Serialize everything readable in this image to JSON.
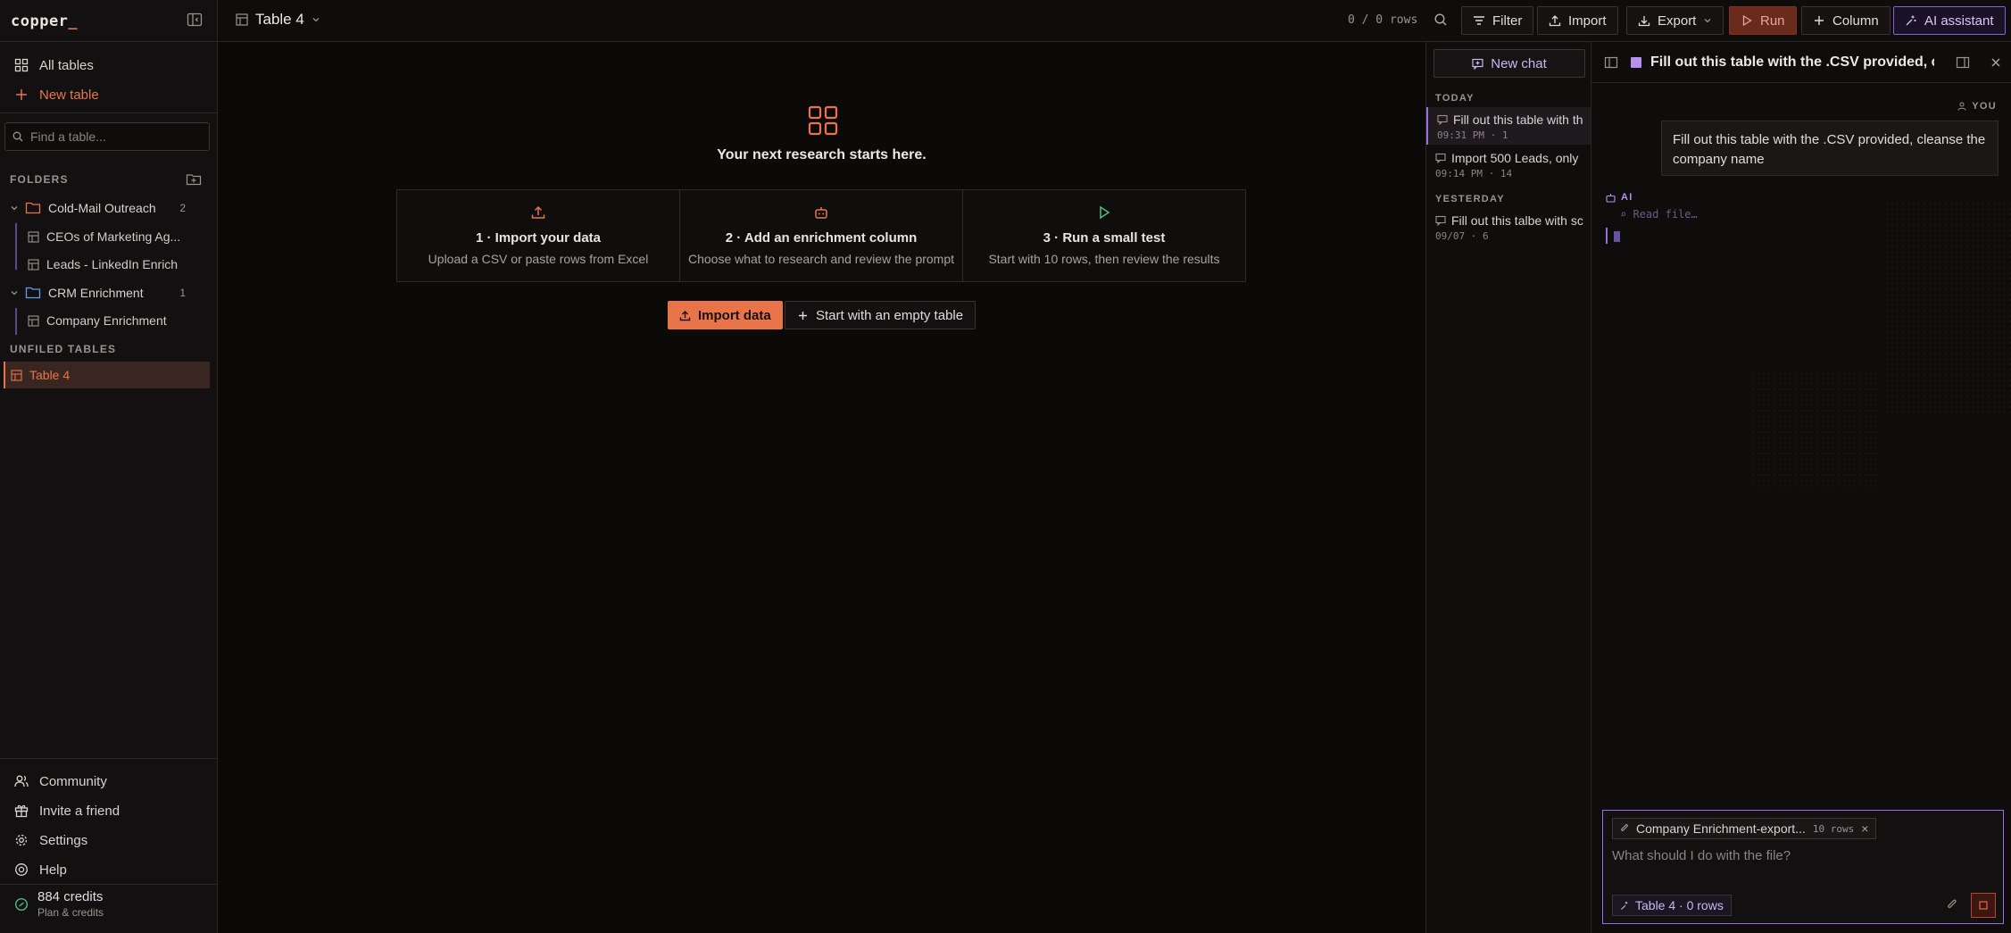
{
  "app": {
    "logo": "copper",
    "logo_cursor": "_"
  },
  "sidebar": {
    "all_tables": "All tables",
    "new_table": "New table",
    "search_placeholder": "Find a table...",
    "folders_label": "FOLDERS",
    "folders": [
      {
        "name": "Cold-Mail Outreach",
        "count": "2",
        "tables": [
          "CEOs of Marketing Ag...",
          "Leads - LinkedIn Enrich"
        ]
      },
      {
        "name": "CRM Enrichment",
        "count": "1",
        "tables": [
          "Company Enrichment"
        ]
      }
    ],
    "unfiled_label": "UNFILED TABLES",
    "unfiled": [
      "Table 4"
    ],
    "bottom": [
      "Community",
      "Invite a friend",
      "Settings",
      "Help"
    ],
    "credits": {
      "amount": "884 credits",
      "sub": "Plan & credits"
    }
  },
  "topbar": {
    "title": "Table 4",
    "rows": "0 / 0 rows",
    "buttons": {
      "filter": "Filter",
      "import": "Import",
      "export": "Export",
      "run": "Run",
      "column": "Column",
      "ai": "AI assistant"
    }
  },
  "main": {
    "hero": "Your next research starts here.",
    "steps": [
      {
        "title": "1 · Import your data",
        "desc": "Upload a CSV or paste rows from Excel"
      },
      {
        "title": "2 · Add an enrichment column",
        "desc": "Choose what to research and review the prompt"
      },
      {
        "title": "3 · Run a small test",
        "desc": "Start with 10 rows, then review the results"
      }
    ],
    "import_btn": "Import data",
    "empty_btn": "Start with an empty table"
  },
  "history": {
    "new_chat": "New chat",
    "groups": [
      {
        "label": "TODAY",
        "items": [
          {
            "title": "Fill out this table with th",
            "meta": "09:31 PM · 1",
            "active": true
          },
          {
            "title": "Import 500 Leads, only",
            "meta": "09:14 PM · 14",
            "active": false
          }
        ]
      },
      {
        "label": "YESTERDAY",
        "items": [
          {
            "title": "Fill out this talbe with sc",
            "meta": "09/07 · 6",
            "active": false
          }
        ]
      }
    ]
  },
  "chat": {
    "title": "Fill out this table with the .CSV provided, cl...",
    "you_label": "YOU",
    "user_message": "Fill out this table with the .CSV provided, cleanse the company name",
    "ai_label": "AI",
    "read_file": "Read file…",
    "attachment": {
      "name": "Company Enrichment-export...",
      "rows": "10 rows",
      "remove": "×"
    },
    "placeholder": "What should I do with the file?",
    "context": "Table 4 · 0 rows"
  },
  "colors": {
    "accent": "#e8744a",
    "ai": "#9a70e0",
    "bg": "#0d0b0a"
  }
}
